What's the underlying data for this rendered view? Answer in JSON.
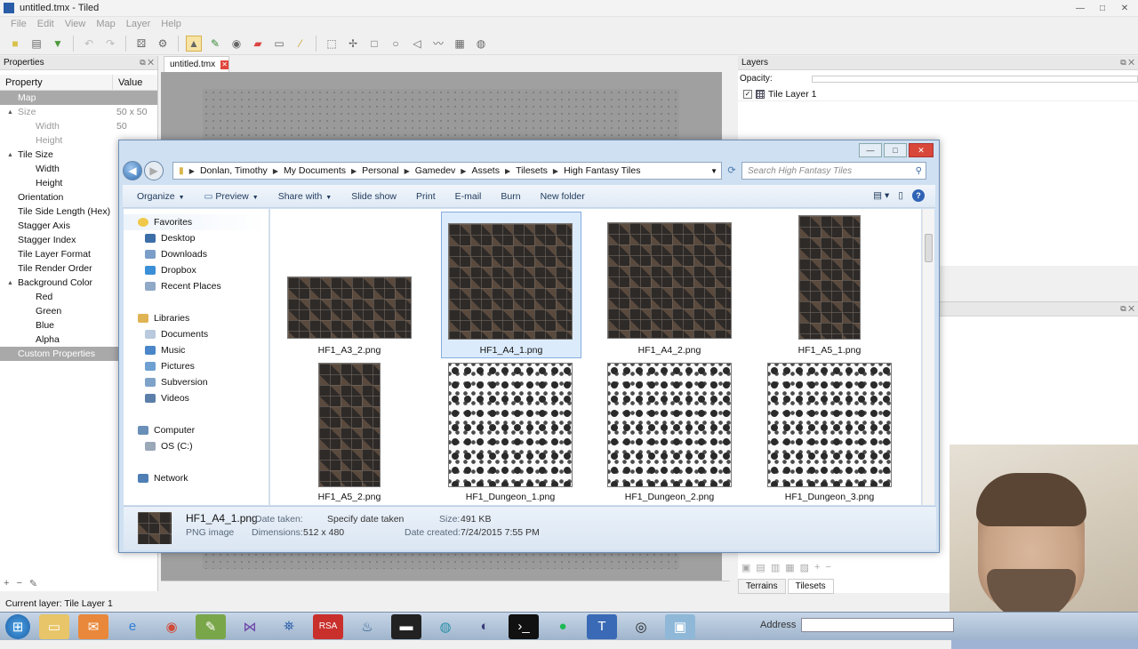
{
  "app": {
    "title": "untitled.tmx - Tiled",
    "menu": [
      "File",
      "Edit",
      "View",
      "Map",
      "Layer",
      "Help"
    ],
    "status": "Current layer: Tile Layer 1"
  },
  "properties": {
    "title": "Properties",
    "col_property": "Property",
    "col_value": "Value",
    "rows": [
      {
        "label": "Map",
        "value": "",
        "indent": 0,
        "expand": "",
        "selected": true
      },
      {
        "label": "Size",
        "value": "50 x 50",
        "indent": 1,
        "expand": "▲",
        "muted": true
      },
      {
        "label": "Width",
        "value": "50",
        "indent": 2,
        "muted": true
      },
      {
        "label": "Height",
        "value": "",
        "indent": 2,
        "muted": true
      },
      {
        "label": "Tile Size",
        "value": "",
        "indent": 1,
        "expand": "▲"
      },
      {
        "label": "Width",
        "value": "",
        "indent": 2
      },
      {
        "label": "Height",
        "value": "",
        "indent": 2
      },
      {
        "label": "Orientation",
        "value": "",
        "indent": 1
      },
      {
        "label": "Tile Side Length (Hex)",
        "value": "",
        "indent": 1
      },
      {
        "label": "Stagger Axis",
        "value": "",
        "indent": 1
      },
      {
        "label": "Stagger Index",
        "value": "",
        "indent": 1
      },
      {
        "label": "Tile Layer Format",
        "value": "",
        "indent": 1
      },
      {
        "label": "Tile Render Order",
        "value": "",
        "indent": 1
      },
      {
        "label": "Background Color",
        "value": "",
        "indent": 1,
        "expand": "▲"
      },
      {
        "label": "Red",
        "value": "",
        "indent": 2
      },
      {
        "label": "Green",
        "value": "",
        "indent": 2
      },
      {
        "label": "Blue",
        "value": "",
        "indent": 2
      },
      {
        "label": "Alpha",
        "value": "",
        "indent": 2
      },
      {
        "label": "Custom Properties",
        "value": "",
        "indent": 0,
        "selected": true
      }
    ]
  },
  "editor": {
    "tab": "untitled.tmx"
  },
  "layers": {
    "title": "Layers",
    "opacity_label": "Opacity:",
    "items": [
      {
        "name": "Tile Layer 1",
        "checked": "✓"
      }
    ]
  },
  "tilesets": {
    "tabs": [
      "Terrains",
      "Tilesets"
    ]
  },
  "explorer": {
    "breadcrumb": [
      "Donlan, Timothy",
      "My Documents",
      "Personal",
      "Gamedev",
      "Assets",
      "Tilesets",
      "High Fantasy Tiles"
    ],
    "search_placeholder": "Search High Fantasy Tiles",
    "commands": [
      "Organize",
      "Preview",
      "Share with",
      "Slide show",
      "Print",
      "E-mail",
      "Burn",
      "New folder"
    ],
    "nav": {
      "favorites": "Favorites",
      "favorites_items": [
        "Desktop",
        "Downloads",
        "Dropbox",
        "Recent Places"
      ],
      "libraries": "Libraries",
      "libraries_items": [
        "Documents",
        "Music",
        "Pictures",
        "Subversion",
        "Videos"
      ],
      "computer": "Computer",
      "computer_items": [
        "OS (C:)"
      ],
      "network": "Network"
    },
    "files": [
      {
        "name": "HF1_A3_2.png",
        "style": "dark"
      },
      {
        "name": "HF1_A4_1.png",
        "style": "dark",
        "selected": true
      },
      {
        "name": "HF1_A4_2.png",
        "style": "dark"
      },
      {
        "name": "HF1_A5_1.png",
        "style": "dark"
      },
      {
        "name": "HF1_A5_2.png",
        "style": "dark"
      },
      {
        "name": "HF1_Dungeon_1.png",
        "style": "bw"
      },
      {
        "name": "HF1_Dungeon_2.png",
        "style": "bw"
      },
      {
        "name": "HF1_Dungeon_3.png",
        "style": "bw"
      }
    ],
    "details": {
      "filename": "HF1_A4_1.png",
      "type": "PNG image",
      "date_taken_label": "Date taken:",
      "date_taken": "Specify date taken",
      "dimensions_label": "Dimensions:",
      "dimensions": "512 x 480",
      "size_label": "Size:",
      "size": "491 KB",
      "date_created_label": "Date created:",
      "date_created": "7/24/2015 7:55 PM"
    }
  },
  "taskbar": {
    "address_label": "Address"
  },
  "colors": {
    "accent": "#2f6cb0",
    "selection": "#dcebfc",
    "close": "#d9473a"
  }
}
